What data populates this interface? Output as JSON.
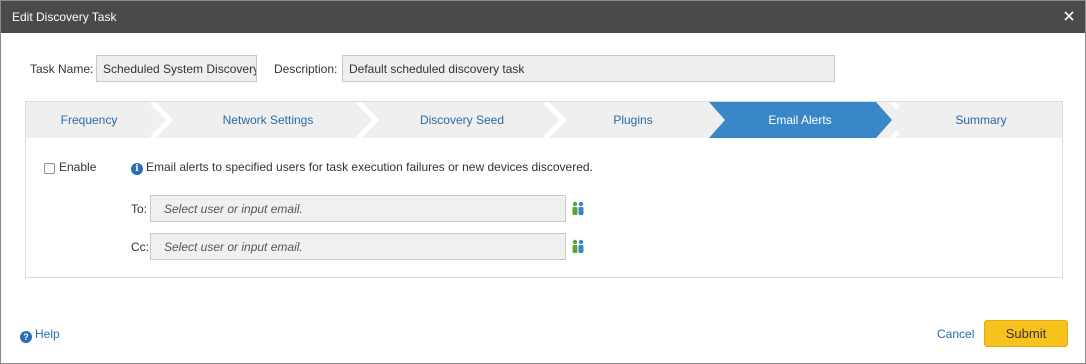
{
  "dialog": {
    "title": "Edit Discovery Task",
    "close_icon": "close-icon"
  },
  "task": {
    "name_label": "Task Name:",
    "name_value": "Scheduled System Discovery",
    "description_label": "Description:",
    "description_value": "Default scheduled discovery task"
  },
  "wizard": {
    "tabs": [
      {
        "label": "Frequency",
        "active": false
      },
      {
        "label": "Network Settings",
        "active": false
      },
      {
        "label": "Discovery Seed",
        "active": false
      },
      {
        "label": "Plugins",
        "active": false
      },
      {
        "label": "Email Alerts",
        "active": true
      },
      {
        "label": "Summary",
        "active": false
      }
    ],
    "active_color": "#3a87c8"
  },
  "email_alerts": {
    "enable_label": "Enable",
    "enabled": false,
    "info_text": "Email alerts to specified users for task execution failures or new devices discovered.",
    "to_label": "To:",
    "to_placeholder": "Select user or input email.",
    "cc_label": "Cc:",
    "cc_placeholder": "Select user or input email.",
    "picker_icon": "user-group-icon"
  },
  "footer": {
    "help_label": "Help",
    "cancel_label": "Cancel",
    "submit_label": "Submit",
    "submit_color": "#f7c21c"
  }
}
